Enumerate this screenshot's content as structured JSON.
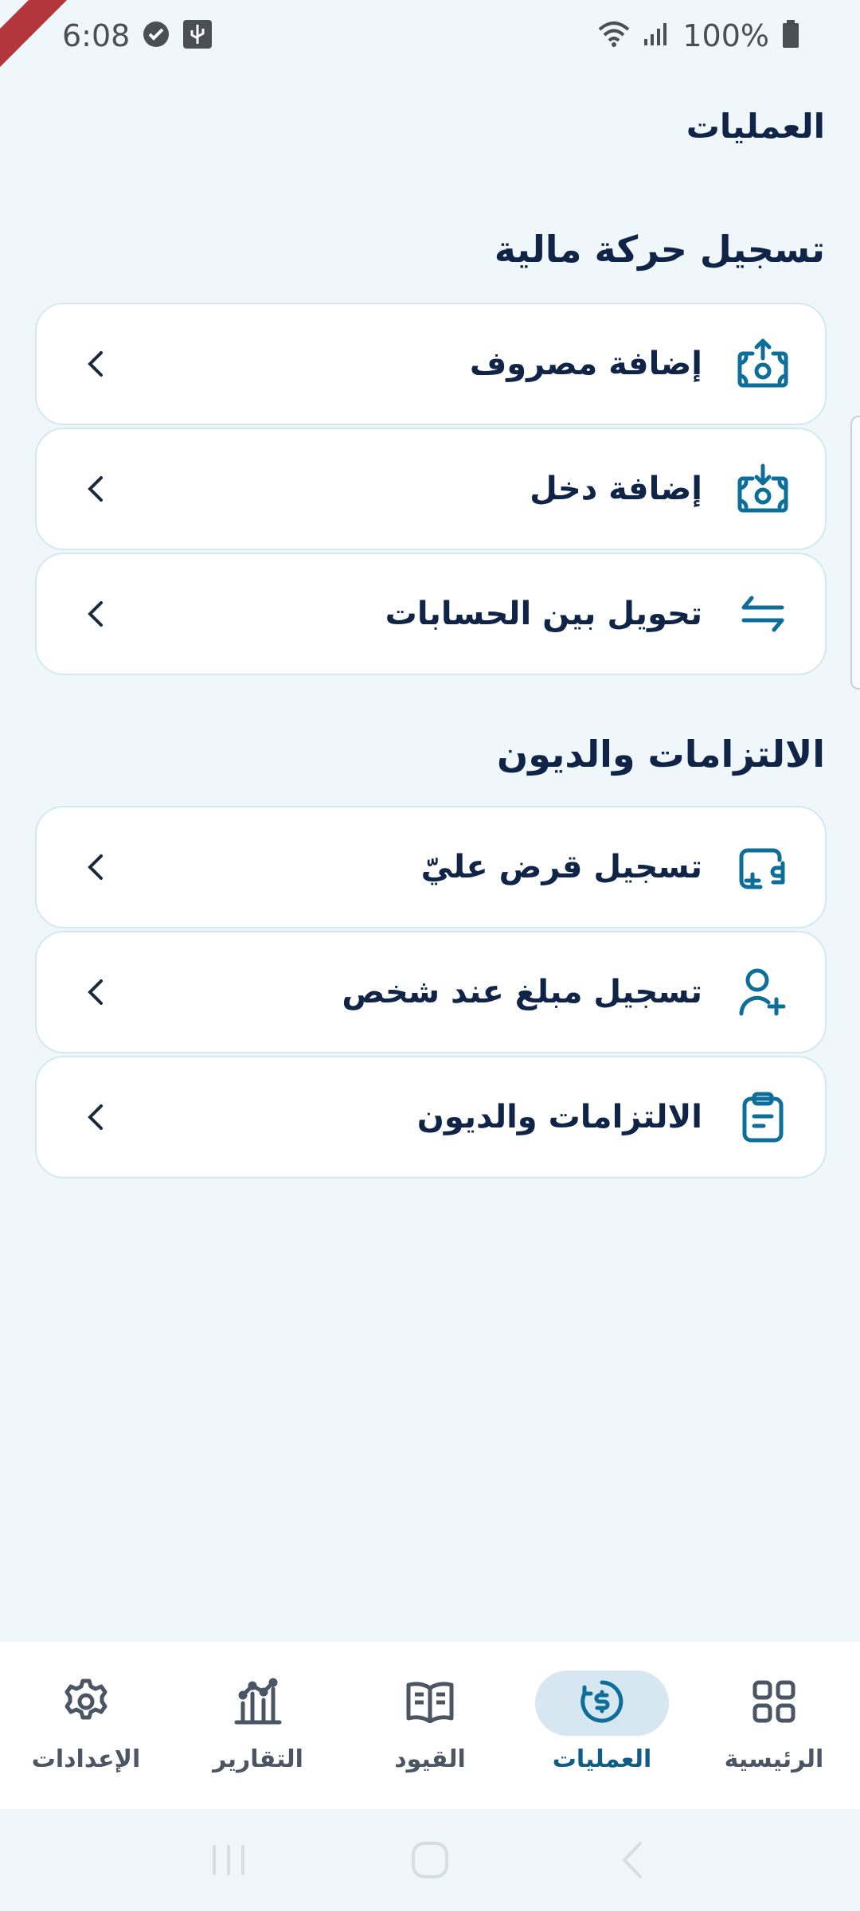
{
  "status_bar": {
    "time": "6:08",
    "battery": "100%",
    "icons": [
      "check-circle-icon",
      "usb-icon",
      "wifi-icon",
      "signal-icon",
      "battery-icon"
    ]
  },
  "header": {
    "title": "العمليات"
  },
  "sections": [
    {
      "title": "تسجيل حركة مالية",
      "items": [
        {
          "label": "إضافة مصروف",
          "icon": "expense-upload-icon"
        },
        {
          "label": "إضافة دخل",
          "icon": "income-download-icon"
        },
        {
          "label": "تحويل بين الحسابات",
          "icon": "transfer-arrows-icon"
        }
      ]
    },
    {
      "title": "الالتزامات والديون",
      "items": [
        {
          "label": "تسجيل قرض عليّ",
          "icon": "wallet-add-icon"
        },
        {
          "label": "تسجيل مبلغ عند شخص",
          "icon": "user-add-icon"
        },
        {
          "label": "الالتزامات والديون",
          "icon": "clipboard-icon"
        }
      ]
    }
  ],
  "bottom_nav": {
    "items": [
      {
        "label": "الرئيسية",
        "icon": "grid-icon",
        "active": false
      },
      {
        "label": "العمليات",
        "icon": "dollar-cycle-icon",
        "active": true
      },
      {
        "label": "القيود",
        "icon": "book-icon",
        "active": false
      },
      {
        "label": "التقارير",
        "icon": "chart-icon",
        "active": false
      },
      {
        "label": "الإعدادات",
        "icon": "gear-icon",
        "active": false
      }
    ]
  },
  "colors": {
    "background": "#f0f7fa",
    "accent": "#0e6e9a",
    "text": "#0f2447",
    "active_pill": "#d6e7f1"
  }
}
